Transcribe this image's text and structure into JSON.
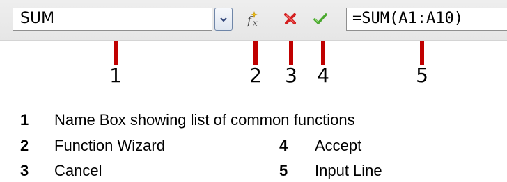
{
  "toolbar": {
    "name_box_value": "SUM",
    "input_line_value": "=SUM(A1:A10)",
    "icons": {
      "dropdown": "chevron-down-icon",
      "function_wizard": "fx-icon",
      "cancel": "cancel-x-icon",
      "accept": "checkmark-icon"
    },
    "colors": {
      "cancel": "#d42020",
      "accept": "#4aa82e",
      "callout": "#c00000"
    }
  },
  "callouts": [
    "1",
    "2",
    "3",
    "4",
    "5"
  ],
  "legend": [
    {
      "num": "1",
      "text": "Name Box showing list of common functions"
    },
    {
      "num": "2",
      "text": "Function Wizard"
    },
    {
      "num": "4",
      "text": "Accept"
    },
    {
      "num": "3",
      "text": "Cancel"
    },
    {
      "num": "5",
      "text": "Input Line"
    }
  ]
}
